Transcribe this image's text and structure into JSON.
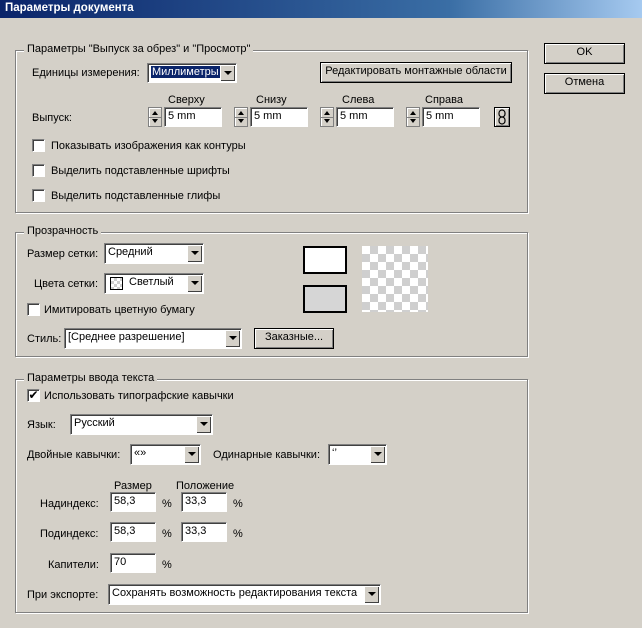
{
  "window": {
    "title": "Параметры документа"
  },
  "dialog_buttons": {
    "ok": "OK",
    "cancel": "Отмена"
  },
  "bleed": {
    "legend": "Параметры \"Выпуск за обрез\" и \"Просмотр\"",
    "units_label": "Единицы измерения:",
    "units_value": "Миллиметры",
    "edit_artboards": "Редактировать монтажные области",
    "bleed_label": "Выпуск:",
    "top_label": "Сверху",
    "top_value": "5 mm",
    "bottom_label": "Снизу",
    "bottom_value": "5 mm",
    "left_label": "Слева",
    "left_value": "5 mm",
    "right_label": "Справа",
    "right_value": "5 mm",
    "chk_outline": "Показывать изображения как контуры",
    "chk_fonts": "Выделить подставленные шрифты",
    "chk_glyphs": "Выделить подставленные глифы"
  },
  "transparency": {
    "legend": "Прозрачность",
    "grid_size_label": "Размер сетки:",
    "grid_size_value": "Средний",
    "grid_colors_label": "Цвета сетки:",
    "grid_colors_value": "Светлый",
    "simulate_paper": "Имитировать цветную бумагу",
    "style_label": "Стиль:",
    "style_value": "[Среднее разрешение]",
    "custom_button": "Заказные...",
    "swatch_top_color": "#ffffff",
    "swatch_bottom_color": "#d6d6d6"
  },
  "type": {
    "legend": "Параметры ввода текста",
    "typographic_quotes": "Использовать типографские кавычки",
    "typographic_quotes_checked": "✔",
    "language_label": "Язык:",
    "language_value": "Русский",
    "double_quotes_label": "Двойные кавычки:",
    "double_quotes_value": "«»",
    "single_quotes_label": "Одинарные кавычки:",
    "single_quotes_value": "‘’",
    "size_header": "Размер",
    "position_header": "Положение",
    "superscript_label": "Надиндекс:",
    "superscript_size": "58,3",
    "superscript_position": "33,3",
    "subscript_label": "Подиндекс:",
    "subscript_size": "58,3",
    "subscript_position": "33,3",
    "smallcaps_label": "Капители:",
    "smallcaps_value": "70",
    "percent": "%",
    "export_label": "При экспорте:",
    "export_value": "Сохранять возможность редактирования текста"
  }
}
